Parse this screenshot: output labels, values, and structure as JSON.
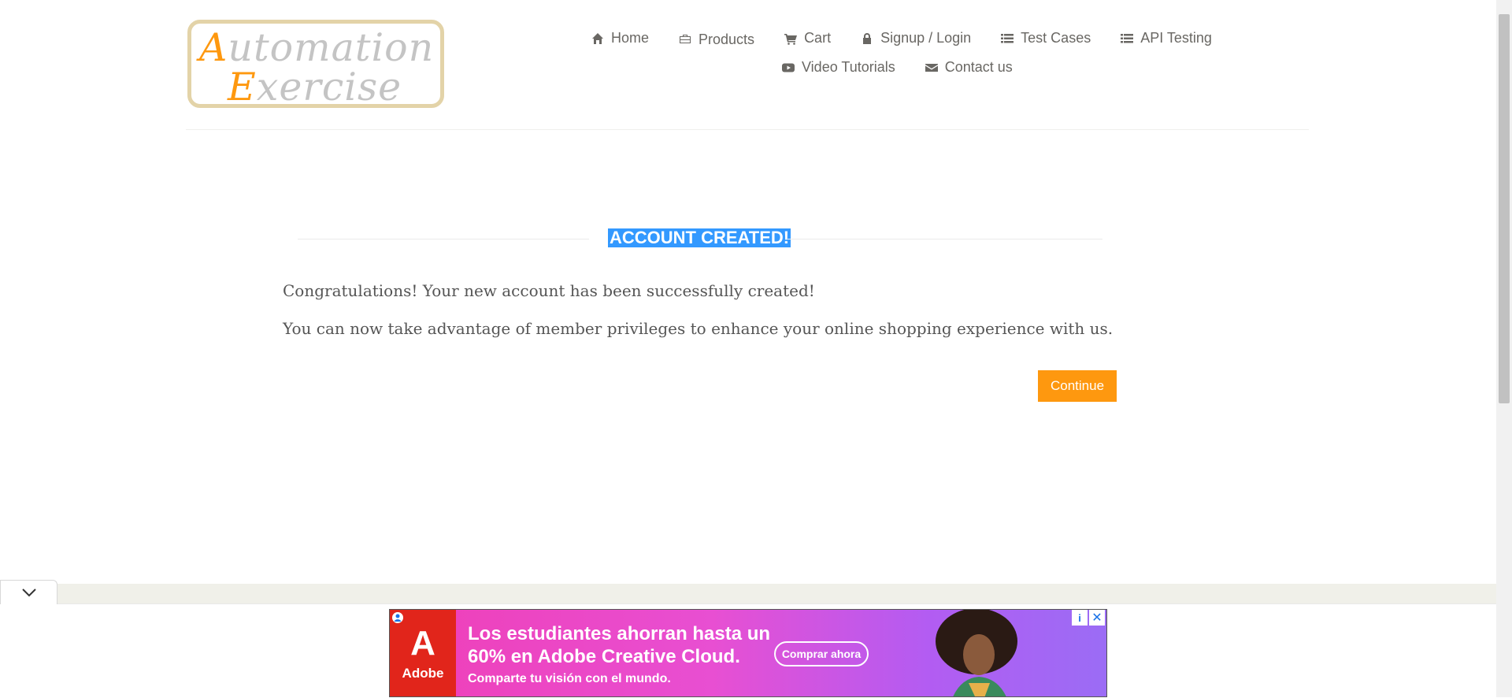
{
  "logo": {
    "line1_cap": "A",
    "line1_rest": "utomation",
    "line2_cap": "E",
    "line2_rest": "xercise"
  },
  "nav": {
    "items": [
      {
        "label": "Home",
        "icon": "home-icon"
      },
      {
        "label": "Products",
        "icon": "briefcase-icon"
      },
      {
        "label": "Cart",
        "icon": "cart-icon"
      },
      {
        "label": "Signup / Login",
        "icon": "lock-icon"
      },
      {
        "label": "Test Cases",
        "icon": "list-icon"
      },
      {
        "label": "API Testing",
        "icon": "list-icon"
      },
      {
        "label": "Video Tutorials",
        "icon": "youtube-icon"
      },
      {
        "label": "Contact us",
        "icon": "envelope-icon"
      }
    ]
  },
  "main": {
    "title": "ACCOUNT CREATED!",
    "message1": "Congratulations! Your new account has been successfully created!",
    "message2": "You can now take advantage of member privileges to enhance your online shopping experience with us.",
    "continue_label": "Continue"
  },
  "ad": {
    "brand": "Adobe",
    "headline": "Los estudiantes ahorran hasta un 60% en Adobe Creative Cloud.",
    "sub": "Comparte tu visión con el mundo.",
    "cta": "Comprar ahora"
  },
  "colors": {
    "accent": "#fe980f",
    "selection": "#3399ff",
    "ad_gradient_start": "#ef3fb7",
    "ad_gradient_end": "#9b6cf5"
  }
}
